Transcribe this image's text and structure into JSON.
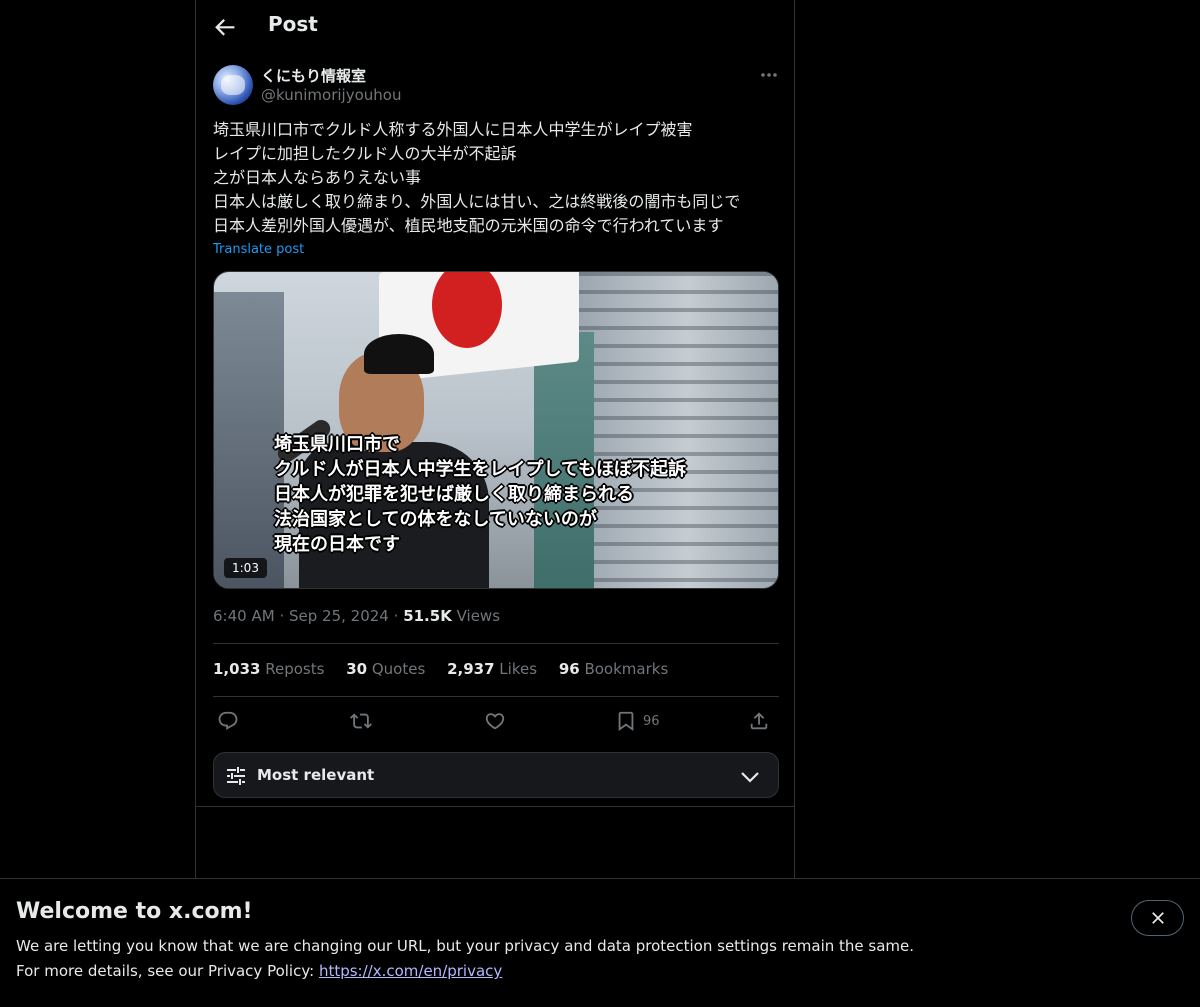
{
  "header": {
    "title": "Post"
  },
  "post": {
    "author": {
      "display_name": "くにもり情報室",
      "handle": "@kunimorijyouhou"
    },
    "text_lines": [
      "埼玉県川口市でクルド人称する外国人に日本人中学生がレイプ被害",
      "レイプに加担したクルド人の大半が不起訴",
      "之が日本人ならありえない事",
      "日本人は厳しく取り締まり、外国人には甘い、之は終戦後の闇市も同じで",
      "日本人差別外国人優遇が、植民地支配の元米国の命令で行われています"
    ],
    "translate_label": "Translate post",
    "media": {
      "overlay_lines": [
        "埼玉県川口市で",
        "クルド人が日本人中学生をレイプしてもほぼ不起訴",
        "日本人が犯罪を犯せば厳しく取り締まられる",
        "法治国家としての体をなしていないのが",
        "現在の日本です"
      ],
      "duration": "1:03"
    },
    "time": "6:40 AM",
    "separator": "·",
    "date": "Sep 25, 2024",
    "views_count": "51.5K",
    "views_label": "Views",
    "stats": {
      "reposts_count": "1,033",
      "reposts_label": "Reposts",
      "quotes_count": "30",
      "quotes_label": "Quotes",
      "likes_count": "2,937",
      "likes_label": "Likes",
      "bookmarks_count": "96",
      "bookmarks_label": "Bookmarks"
    },
    "actions": {
      "bookmark_count": "96"
    }
  },
  "sort": {
    "label": "Most relevant"
  },
  "banner": {
    "title": "Welcome to x.com!",
    "line1": "We are letting you know that we are changing our URL, but your privacy and data protection settings remain the same.",
    "line2_prefix": "For more details, see our Privacy Policy: ",
    "link_text": "https://x.com/en/privacy"
  },
  "colors": {
    "background": "#000000",
    "text_primary": "#e7e9ea",
    "text_secondary": "#71767b",
    "accent_blue": "#1d9bf0",
    "border": "#2f3336"
  },
  "icons": [
    "back-arrow-icon",
    "more-icon",
    "reply-icon",
    "repost-icon",
    "like-icon",
    "bookmark-icon",
    "share-icon",
    "sliders-icon",
    "chevron-down-icon",
    "close-icon"
  ]
}
